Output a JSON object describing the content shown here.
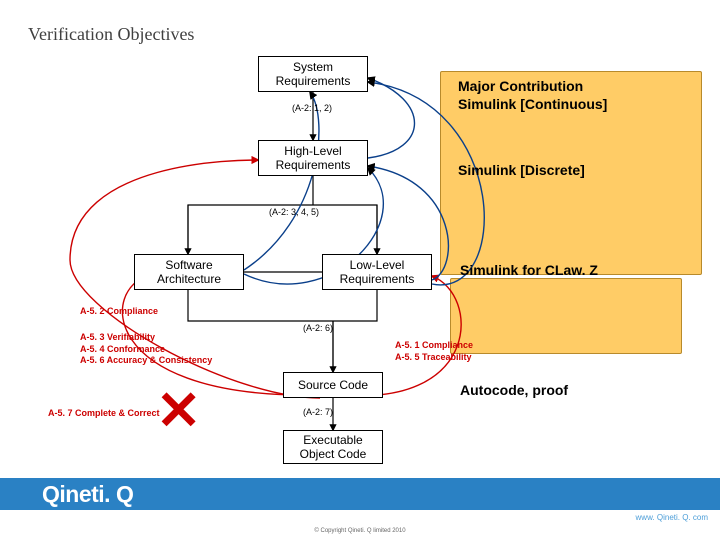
{
  "title": "Verification Objectives",
  "boxes": {
    "system": "System\nRequirements",
    "high": "High-Level\nRequirements",
    "arch": "Software\nArchitecture",
    "low": "Low-Level\nRequirements",
    "source": "Source Code",
    "exe": "Executable\nObject Code"
  },
  "flow_labels": {
    "a21": "(A-2: 1, 2)",
    "a23": "(A-2: 3, 4, 5)",
    "a26": "(A-2: 6)",
    "a27": "(A-2: 7)"
  },
  "red_labels": {
    "a52_compliance": "A-5. 2 Compliance",
    "a53_block": "A-5. 3 Verifiability\nA-5. 4 Conformance\nA-5. 6 Accuracy & Consistency",
    "a51_block": "A-5. 1 Compliance\nA-5. 5 Traceability",
    "a57": "A-5. 7 Complete & Correct"
  },
  "notes": {
    "major": "Major Contribution\nSimulink [Continuous]",
    "discrete": "Simulink [Discrete]",
    "clawz": "Simulink for CLaw. Z",
    "autocode": "Autocode, proof"
  },
  "cross_mark": "✕",
  "footer": {
    "logo": "Qineti. Q",
    "url": "www. Qineti. Q. com",
    "copyright": "© Copyright Qineti. Q limited 2010"
  }
}
